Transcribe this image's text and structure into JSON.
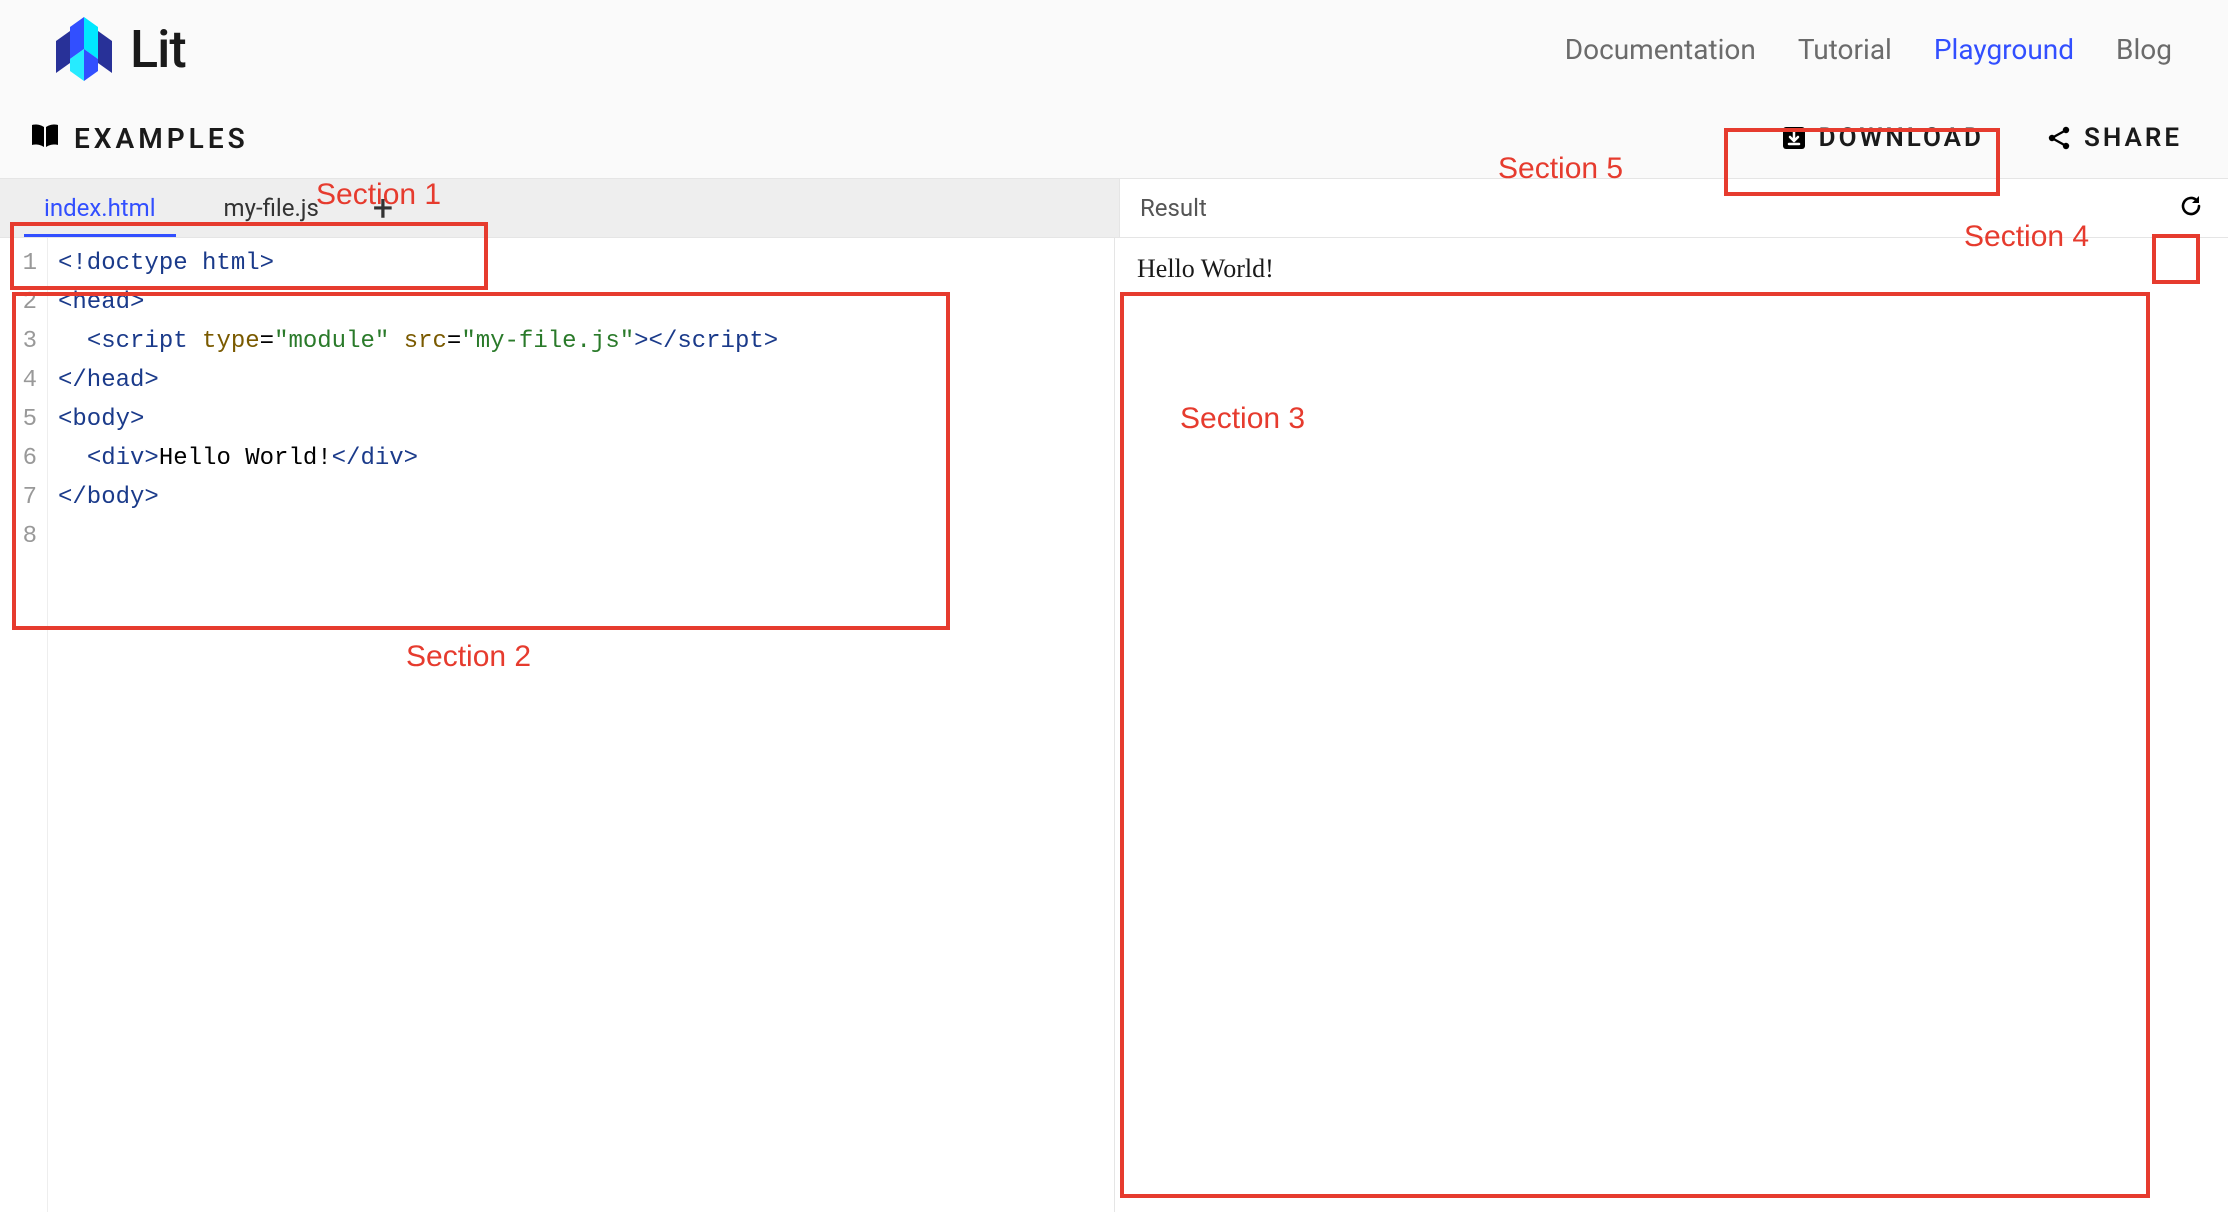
{
  "brand": {
    "name": "Lit"
  },
  "nav": {
    "links": [
      {
        "label": "Documentation",
        "active": false
      },
      {
        "label": "Tutorial",
        "active": false
      },
      {
        "label": "Playground",
        "active": true
      },
      {
        "label": "Blog",
        "active": false
      }
    ]
  },
  "toolbar": {
    "examples_label": "EXAMPLES",
    "download_label": "DOWNLOAD",
    "share_label": "SHARE"
  },
  "tabs": {
    "items": [
      {
        "name": "index.html",
        "active": true
      },
      {
        "name": "my-file.js",
        "active": false
      }
    ],
    "add_glyph": "+"
  },
  "result": {
    "title": "Result",
    "output_text": "Hello World!"
  },
  "editor": {
    "line_count": 8,
    "lines": [
      {
        "tokens": [
          {
            "t": "<!doctype html>",
            "c": "tag"
          }
        ]
      },
      {
        "tokens": [
          {
            "t": "<head>",
            "c": "tag"
          }
        ]
      },
      {
        "tokens": [
          {
            "t": "  ",
            "c": "txt"
          },
          {
            "t": "<script",
            "c": "tag"
          },
          {
            "t": " ",
            "c": "txt"
          },
          {
            "t": "type",
            "c": "attr"
          },
          {
            "t": "=",
            "c": "txt"
          },
          {
            "t": "\"module\"",
            "c": "str"
          },
          {
            "t": " ",
            "c": "txt"
          },
          {
            "t": "src",
            "c": "attr"
          },
          {
            "t": "=",
            "c": "txt"
          },
          {
            "t": "\"my-file.js\"",
            "c": "str"
          },
          {
            "t": "></script>",
            "c": "tag"
          }
        ]
      },
      {
        "tokens": [
          {
            "t": "</head>",
            "c": "tag"
          }
        ]
      },
      {
        "tokens": [
          {
            "t": "<body>",
            "c": "tag"
          }
        ]
      },
      {
        "tokens": [
          {
            "t": "  ",
            "c": "txt"
          },
          {
            "t": "<div>",
            "c": "tag"
          },
          {
            "t": "Hello World!",
            "c": "txt"
          },
          {
            "t": "</div>",
            "c": "tag"
          }
        ]
      },
      {
        "tokens": [
          {
            "t": "</body>",
            "c": "tag"
          }
        ]
      },
      {
        "tokens": []
      }
    ]
  },
  "annotations": {
    "section1": "Section 1",
    "section2": "Section 2",
    "section3": "Section 3",
    "section4": "Section 4",
    "section5": "Section 5"
  },
  "colors": {
    "accent": "#324fff",
    "annotation": "#e63b2e"
  }
}
